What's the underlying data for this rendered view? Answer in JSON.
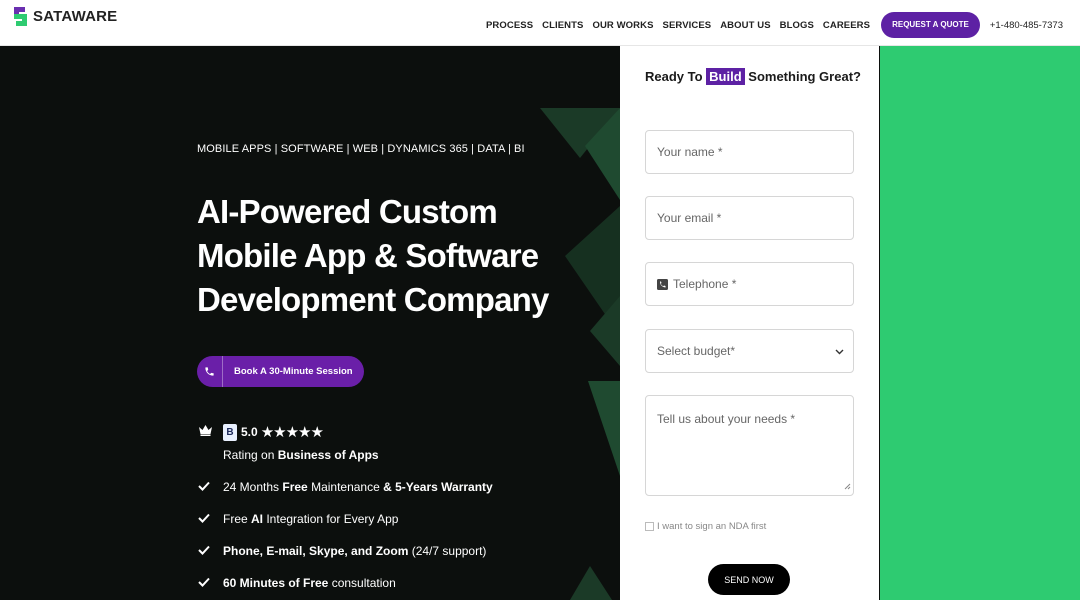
{
  "nav": {
    "logo_text": "SATAWARE",
    "items": [
      "PROCESS",
      "CLIENTS",
      "OUR WORKS",
      "SERVICES",
      "ABOUT US",
      "BLOGS",
      "CAREERS"
    ],
    "quote_button": "REQUEST A QUOTE",
    "phone": "+1-480-485-7373"
  },
  "hero": {
    "tagline": "MOBILE APPS | SOFTWARE | WEB | DYNAMICS 365 | DATA | BI",
    "headline_lines": [
      "AI-Powered Custom",
      "Mobile App & Software",
      "Development Company"
    ],
    "book_button": "Book A 30-Minute Session",
    "rating": {
      "score": "5.0",
      "stars": 5,
      "prefix": "Rating on ",
      "source": "Business of Apps"
    },
    "features": [
      {
        "parts": [
          [
            "24 Months ",
            false
          ],
          [
            "Free",
            true
          ],
          [
            " Maintenance ",
            false
          ],
          [
            "& 5-Years Warranty",
            true
          ]
        ]
      },
      {
        "parts": [
          [
            "Free ",
            false
          ],
          [
            "AI",
            true
          ],
          [
            " Integration for Every App",
            false
          ]
        ]
      },
      {
        "parts": [
          [
            "Phone, E-mail, Skype, and Zoom",
            true
          ],
          [
            " (24/7 support)",
            false
          ]
        ]
      },
      {
        "parts": [
          [
            "60 Minutes of Free",
            true
          ],
          [
            " consultation",
            false
          ]
        ]
      }
    ]
  },
  "form": {
    "title_pre": "Ready To ",
    "title_highlight": "Build",
    "title_post": " Something Great?",
    "name_placeholder": "Your name *",
    "email_placeholder": "Your email *",
    "phone_placeholder": "Telephone *",
    "budget_placeholder": "Select budget*",
    "needs_placeholder": "Tell us about your needs *",
    "nda_label": "I want to sign an NDA first",
    "send_button": "SEND NOW"
  },
  "colors": {
    "brand_purple": "#5d21a4",
    "accent_green": "#2ecb71",
    "hero_bg": "#0c0f0d"
  }
}
